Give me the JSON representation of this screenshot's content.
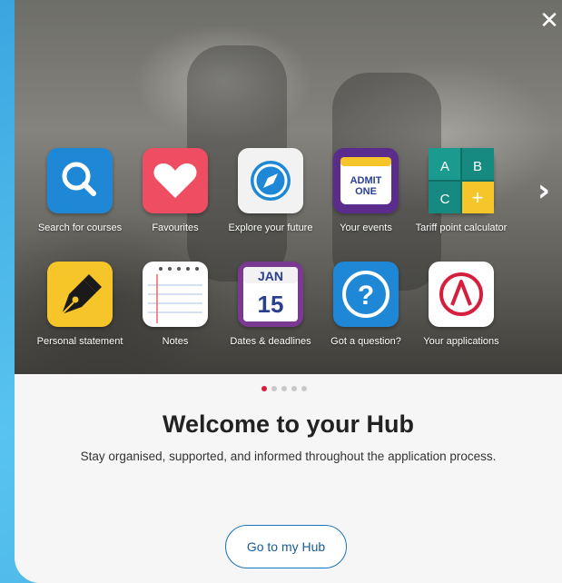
{
  "close_glyph": "✕",
  "next_glyph": "›",
  "tiles": [
    {
      "label": "Search for courses",
      "icon": "search-icon",
      "color": "#1e88d6"
    },
    {
      "label": "Favourites",
      "icon": "heart-icon",
      "color": "#ef4d62"
    },
    {
      "label": "Explore your future",
      "icon": "compass-icon",
      "color": "#f2f2f2"
    },
    {
      "label": "Your events",
      "icon": "ticket-icon",
      "color": "#5a2d8c"
    },
    {
      "label": "Tariff point calculator",
      "icon": "calculator-icon",
      "color": "#1b9b8f"
    },
    {
      "label": "Personal statement",
      "icon": "pen-icon",
      "color": "#f6c52a"
    },
    {
      "label": "Notes",
      "icon": "notepad-icon",
      "color": "#ffffff"
    },
    {
      "label": "Dates & deadlines",
      "icon": "calendar-icon",
      "color": "#7a3a92"
    },
    {
      "label": "Got a question?",
      "icon": "question-icon",
      "color": "#1e88d6"
    },
    {
      "label": "Your applications",
      "icon": "applications-icon",
      "color": "#ffffff"
    }
  ],
  "ticket": {
    "line1": "ADMIT",
    "line2": "ONE"
  },
  "calculator": {
    "keys": [
      "A",
      "B",
      "C",
      "+"
    ]
  },
  "calendar": {
    "month": "JAN",
    "day": "15"
  },
  "question_glyph": "?",
  "pagination": {
    "count": 5,
    "active": 0
  },
  "welcome": {
    "title": "Welcome to your Hub",
    "subtitle": "Stay organised, supported, and informed throughout the application process."
  },
  "cta": {
    "label": "Go to my Hub"
  },
  "colors": {
    "accent": "#1a75bb",
    "dot_active": "#d4203c"
  }
}
